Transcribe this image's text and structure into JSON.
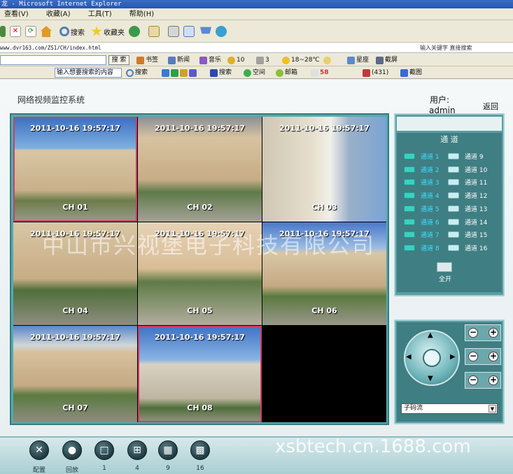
{
  "browser": {
    "title": "龙 - Microsoft Internet Explorer",
    "menu": [
      "查看(V)",
      "收藏(A)",
      "工具(T)",
      "帮助(H)"
    ],
    "toolbar": {
      "search_label": "搜索",
      "favorites_label": "收藏夹"
    },
    "address": "www.dvr163.com/ZS1/CH/index.html",
    "search_hint": "输入关键字 直接搜索",
    "search_button": "搜 索",
    "links": [
      "书签",
      "新闻",
      "音乐",
      "10",
      "3",
      "18~28℃",
      "星座",
      "截屏"
    ],
    "search_placeholder": "输入想要搜索的内容",
    "links2": [
      "搜索",
      "搜索",
      "空间",
      "邮箱",
      "58",
      "(431)",
      "截图"
    ]
  },
  "app": {
    "title": "网络视频监控系统",
    "user_label": "用户:",
    "user_name": "admin",
    "back_label": "返回",
    "cameras": [
      {
        "timestamp": "2011-10-16  19:57:17",
        "label": "CH  01",
        "selected": true
      },
      {
        "timestamp": "2011-10-16  19:57:17",
        "label": "CH  02",
        "selected": false
      },
      {
        "timestamp": "2011-10-16  19:57:17",
        "label": "CH  03",
        "selected": false
      },
      {
        "timestamp": "2011-10-16  19:57:17",
        "label": "CH  04",
        "selected": false
      },
      {
        "timestamp": "2011-10-16  19:57:17",
        "label": "CH  05",
        "selected": false
      },
      {
        "timestamp": "2011-10-16  19:57:17",
        "label": "CH  06",
        "selected": false
      },
      {
        "timestamp": "2011-10-16  19:57:17",
        "label": "CH  07",
        "selected": false
      },
      {
        "timestamp": "2011-10-16  19:57:17",
        "label": "CH  08",
        "selected": true
      },
      {
        "timestamp": "",
        "label": "",
        "selected": false
      }
    ],
    "channel_panel": {
      "header": "通  道",
      "left": [
        "通道  1",
        "通道  2",
        "通道  3",
        "通道  4",
        "通道  5",
        "通道  6",
        "通道  7",
        "通道  8"
      ],
      "right": [
        "通道  9",
        "通道  10",
        "通道  11",
        "通道  12",
        "通道  13",
        "通道  14",
        "通道  15",
        "通道  16"
      ],
      "all_label": "全开"
    },
    "ptz": {
      "stream_value": "子码流"
    },
    "bottom_buttons": [
      {
        "label": "配置",
        "icon": "wrench-icon"
      },
      {
        "label": "回放",
        "icon": "camera-icon"
      },
      {
        "label": "1",
        "icon": "layout-1-icon"
      },
      {
        "label": "4",
        "icon": "layout-4-icon"
      },
      {
        "label": "9",
        "icon": "layout-9-icon"
      },
      {
        "label": "16",
        "icon": "layout-16-icon"
      }
    ]
  },
  "watermarks": {
    "company": "中山市兴视堡电子科技有限公司",
    "site": "xsbtech.cn.1688.com"
  },
  "colors": {
    "panel": "#3f7e83",
    "channel_active": "#3ee0ff",
    "selected_border": "#d23b6a"
  }
}
